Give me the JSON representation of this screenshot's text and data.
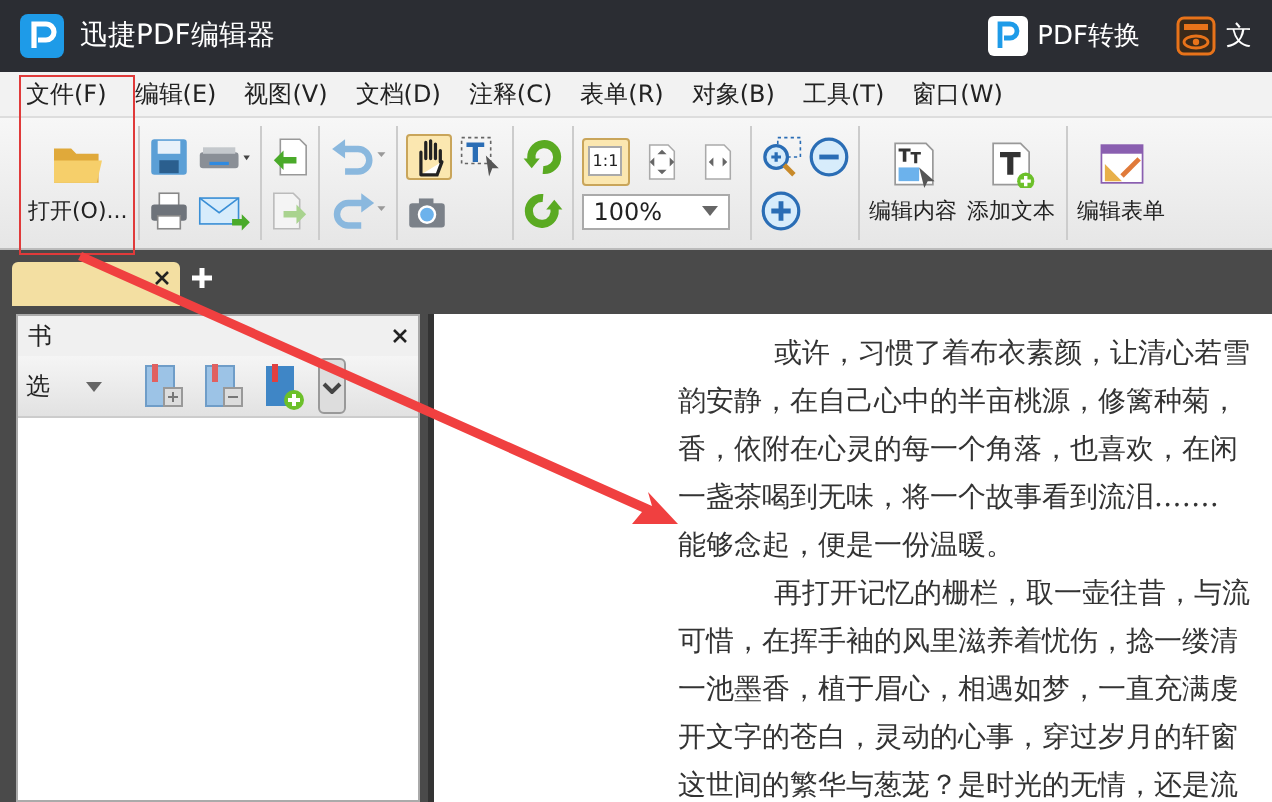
{
  "window": {
    "title": "迅捷PDF编辑器",
    "header_links": [
      {
        "kind": "pdf",
        "label": "PDF转换"
      },
      {
        "kind": "ocr",
        "label": "文"
      }
    ]
  },
  "menu": [
    "文件(F)",
    "编辑(E)",
    "视图(V)",
    "文档(D)",
    "注释(C)",
    "表单(R)",
    "对象(B)",
    "工具(T)",
    "窗口(W)"
  ],
  "toolbar": {
    "open_label": "打开(O)...",
    "hand_tool": {
      "selected": true
    },
    "text_select_tool": {
      "selected": false
    },
    "fit_modes": [
      {
        "label": "1:1",
        "selected": true
      },
      {
        "selected": false
      },
      {
        "selected": false
      }
    ],
    "zoom": "100%",
    "actions": [
      "编辑内容",
      "添加文本",
      "编辑表单"
    ]
  },
  "panel": {
    "title": "书",
    "dropdown": "选"
  },
  "document": {
    "lines": [
      {
        "kind": "para",
        "text": "或许，习惯了着布衣素颜，让清心若雪"
      },
      {
        "kind": "line",
        "text": "韵安静，在自己心中的半亩桃源，修篱种菊，"
      },
      {
        "kind": "line",
        "text": "香，依附在心灵的每一个角落，也喜欢，在闲"
      },
      {
        "kind": "line",
        "text": "一盏茶喝到无味，将一个故事看到流泪.……"
      },
      {
        "kind": "line",
        "text": "能够念起，便是一份温暖。"
      },
      {
        "kind": "para",
        "text": "再打开记忆的栅栏，取一壶往昔，与流"
      },
      {
        "kind": "line",
        "text": "可惜，在挥手袖的风里滋养着忧伤，捻一缕清"
      },
      {
        "kind": "line",
        "text": "一池墨香，植于眉心，相遇如梦，一直充满虔"
      },
      {
        "kind": "line",
        "text": "开文字的苍白，灵动的心事，穿过岁月的轩窗"
      },
      {
        "kind": "line",
        "text": "这世间的繁华与葱茏？是时光的无情，还是流"
      }
    ]
  }
}
